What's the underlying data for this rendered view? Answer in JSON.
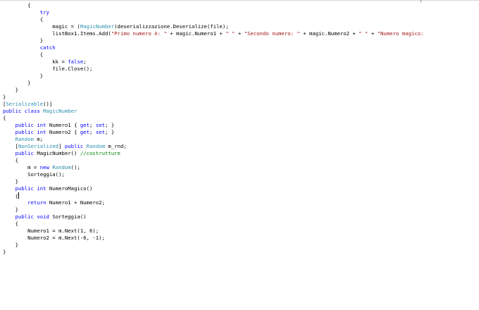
{
  "editor": {
    "colors": {
      "background": "#ffffff",
      "keyword": "#0000ff",
      "type": "#2b91af",
      "string": "#a31515",
      "comment": "#008000",
      "plain": "#000000"
    },
    "lines": [
      [
        {
          "t": "        {",
          "k": "plain"
        }
      ],
      [
        {
          "t": "            ",
          "k": "plain"
        },
        {
          "t": "try",
          "k": "keyword"
        }
      ],
      [
        {
          "t": "            {",
          "k": "plain"
        }
      ],
      [
        {
          "t": "                magic = (",
          "k": "plain"
        },
        {
          "t": "MagicNumber",
          "k": "type"
        },
        {
          "t": ")deserializzazione.Deserialize(file);",
          "k": "plain"
        }
      ],
      [
        {
          "t": "                listBox1.Items.Add(",
          "k": "plain"
        },
        {
          "t": "\"Primo numero è: \"",
          "k": "string"
        },
        {
          "t": " + magic.Numero1 + ",
          "k": "plain"
        },
        {
          "t": "\" \"",
          "k": "string"
        },
        {
          "t": " + ",
          "k": "plain"
        },
        {
          "t": "\"Secondo numero: \"",
          "k": "string"
        },
        {
          "t": " + magic.Numero2 + ",
          "k": "plain"
        },
        {
          "t": "\" \"",
          "k": "string"
        },
        {
          "t": " + ",
          "k": "plain"
        },
        {
          "t": "\"Numero magico:",
          "k": "string"
        }
      ],
      [
        {
          "t": "            }",
          "k": "plain"
        }
      ],
      [
        {
          "t": "            ",
          "k": "plain"
        },
        {
          "t": "catch",
          "k": "keyword"
        }
      ],
      [
        {
          "t": "            {",
          "k": "plain"
        }
      ],
      [
        {
          "t": "                kk = ",
          "k": "plain"
        },
        {
          "t": "false",
          "k": "keyword"
        },
        {
          "t": ";",
          "k": "plain"
        }
      ],
      [
        {
          "t": "                file.Close();",
          "k": "plain"
        }
      ],
      [
        {
          "t": "            }",
          "k": "plain"
        }
      ],
      [
        {
          "t": "        }",
          "k": "plain"
        }
      ],
      [
        {
          "t": "    }",
          "k": "plain"
        }
      ],
      [
        {
          "t": "}",
          "k": "plain"
        }
      ],
      [
        {
          "t": "[",
          "k": "plain"
        },
        {
          "t": "Serializable",
          "k": "type"
        },
        {
          "t": "()]",
          "k": "plain"
        }
      ],
      [
        {
          "t": "public",
          "k": "keyword"
        },
        {
          "t": " ",
          "k": "plain"
        },
        {
          "t": "class",
          "k": "keyword"
        },
        {
          "t": " ",
          "k": "plain"
        },
        {
          "t": "MagicNumber",
          "k": "type"
        }
      ],
      [
        {
          "t": "{",
          "k": "plain"
        }
      ],
      [
        {
          "t": "    ",
          "k": "plain"
        },
        {
          "t": "public",
          "k": "keyword"
        },
        {
          "t": " ",
          "k": "plain"
        },
        {
          "t": "int",
          "k": "keyword"
        },
        {
          "t": " Numero1 { ",
          "k": "plain"
        },
        {
          "t": "get",
          "k": "keyword"
        },
        {
          "t": "; ",
          "k": "plain"
        },
        {
          "t": "set",
          "k": "keyword"
        },
        {
          "t": "; }",
          "k": "plain"
        }
      ],
      [
        {
          "t": "    ",
          "k": "plain"
        },
        {
          "t": "public",
          "k": "keyword"
        },
        {
          "t": " ",
          "k": "plain"
        },
        {
          "t": "int",
          "k": "keyword"
        },
        {
          "t": " Numero2 { ",
          "k": "plain"
        },
        {
          "t": "get",
          "k": "keyword"
        },
        {
          "t": "; ",
          "k": "plain"
        },
        {
          "t": "set",
          "k": "keyword"
        },
        {
          "t": "; }",
          "k": "plain"
        }
      ],
      [
        {
          "t": "    ",
          "k": "plain"
        },
        {
          "t": "Random",
          "k": "type"
        },
        {
          "t": " m;",
          "k": "plain"
        }
      ],
      [
        {
          "t": "    [",
          "k": "plain"
        },
        {
          "t": "NonSerialized",
          "k": "type"
        },
        {
          "t": "] ",
          "k": "plain"
        },
        {
          "t": "public",
          "k": "keyword"
        },
        {
          "t": " ",
          "k": "plain"
        },
        {
          "t": "Random",
          "k": "type"
        },
        {
          "t": " m_rnd;",
          "k": "plain"
        }
      ],
      [
        {
          "t": "    ",
          "k": "plain"
        },
        {
          "t": "public",
          "k": "keyword"
        },
        {
          "t": " MagicNumber() ",
          "k": "plain"
        },
        {
          "t": "//costrutture",
          "k": "comment"
        }
      ],
      [
        {
          "t": "    {",
          "k": "plain"
        }
      ],
      [
        {
          "t": "        m = ",
          "k": "plain"
        },
        {
          "t": "new",
          "k": "keyword"
        },
        {
          "t": " ",
          "k": "plain"
        },
        {
          "t": "Random",
          "k": "type"
        },
        {
          "t": "();",
          "k": "plain"
        }
      ],
      [
        {
          "t": "        Sorteggia();",
          "k": "plain"
        }
      ],
      [
        {
          "t": "    }",
          "k": "plain"
        }
      ],
      [
        {
          "t": "    ",
          "k": "plain"
        },
        {
          "t": "public",
          "k": "keyword"
        },
        {
          "t": " ",
          "k": "plain"
        },
        {
          "t": "int",
          "k": "keyword"
        },
        {
          "t": " NumeroMagico()",
          "k": "plain"
        }
      ],
      [
        {
          "t": "    {",
          "k": "plain"
        },
        {
          "t": "",
          "k": "caret"
        }
      ],
      [
        {
          "t": "        ",
          "k": "plain"
        },
        {
          "t": "return",
          "k": "keyword"
        },
        {
          "t": " Numero1 + Numero2;",
          "k": "plain"
        }
      ],
      [
        {
          "t": "    }",
          "k": "plain"
        }
      ],
      [
        {
          "t": "    ",
          "k": "plain"
        },
        {
          "t": "public",
          "k": "keyword"
        },
        {
          "t": " ",
          "k": "plain"
        },
        {
          "t": "void",
          "k": "keyword"
        },
        {
          "t": " Sorteggia()",
          "k": "plain"
        }
      ],
      [
        {
          "t": "    {",
          "k": "plain"
        }
      ],
      [
        {
          "t": "        Numero1 = m.Next(1, 6);",
          "k": "plain"
        }
      ],
      [
        {
          "t": "        Numero2 = m.Next(-6, -1);",
          "k": "plain"
        }
      ],
      [
        {
          "t": "    }",
          "k": "plain"
        }
      ],
      [
        {
          "t": "}",
          "k": "plain"
        }
      ]
    ]
  }
}
